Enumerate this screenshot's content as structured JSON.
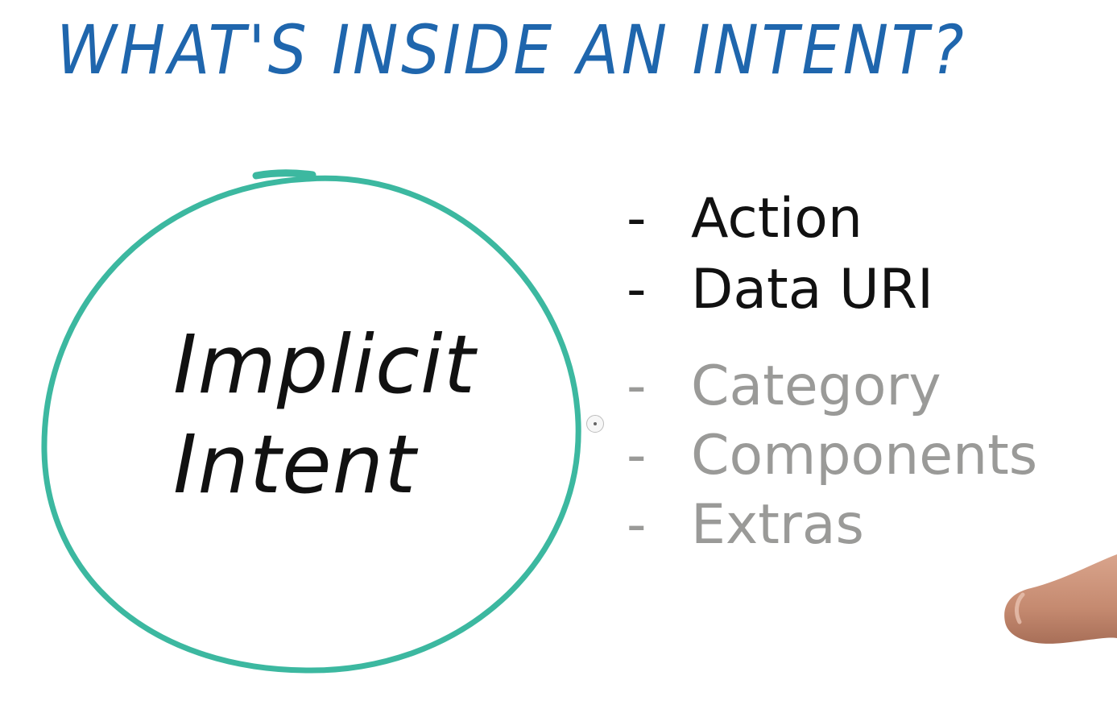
{
  "title": "WHAT'S INSIDE AN INTENT?",
  "circle": {
    "line1": "Implicit",
    "line2": "Intent"
  },
  "list": {
    "dash": "-",
    "items": [
      {
        "label": "Action",
        "emphasis": "active"
      },
      {
        "label": "Data URI",
        "emphasis": "active"
      },
      {
        "label": "Category",
        "emphasis": "muted"
      },
      {
        "label": "Components",
        "emphasis": "muted"
      },
      {
        "label": "Extras",
        "emphasis": "muted"
      }
    ]
  },
  "colors": {
    "title": "#1f66ad",
    "circle": "#3cb8a0",
    "active_text": "#111111",
    "muted_text": "#9a9a98",
    "finger": "#c9917a"
  },
  "icons": {
    "cursor": "cursor-dot-icon",
    "hand": "pointing-finger-icon"
  }
}
